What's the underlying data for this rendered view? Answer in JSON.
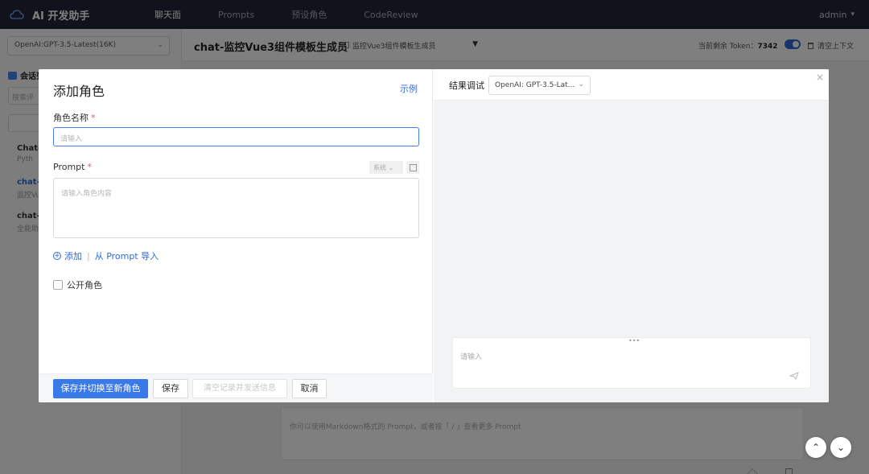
{
  "topbar": {
    "app_title": "AI 开发助手",
    "nav": [
      "聊天面",
      "Prompts",
      "预设角色",
      "CodeReview"
    ],
    "user": "admin"
  },
  "sidebar": {
    "model_select": "OpenAI:GPT-3.5-Latest(16K)",
    "conversation_header": "会话列",
    "search_placeholder": "搜索评",
    "items": [
      {
        "title": "Chat-",
        "subtitle": "Pyth"
      },
      {
        "title": "chat-:",
        "subtitle": "监控Vu"
      },
      {
        "title": "chat-I",
        "subtitle": "全能助"
      }
    ]
  },
  "header": {
    "title": "chat-监控Vue3组件模板生成员",
    "role_chip": "监控Vue3组件模板生成员",
    "token_label": "当前剩余 Token：",
    "token_value": "7342",
    "clear_context": "清空上下文"
  },
  "background_chat": {
    "placeholder": "你可以使用Markdown格式的 Prompt，或者按「 / 」查看更多 Prompt"
  },
  "modal": {
    "title": "添加角色",
    "example_link": "示例",
    "name_label": "角色名称",
    "name_placeholder": "请输入",
    "prompt_label": "Prompt",
    "system_select": "系统",
    "prompt_placeholder": "请输入角色内容",
    "add_label": "添加",
    "import_label": "从 Prompt 导入",
    "public_label": "公开角色",
    "buttons": {
      "save_switch": "保存并切换至新角色",
      "save": "保存",
      "clear_records": "清空记录并发送信息",
      "cancel": "取消"
    },
    "debug_label": "结果调试",
    "debug_model": "OpenAI: GPT-3.5-Lat...",
    "debug_placeholder": "请输入"
  },
  "colors": {
    "primary": "#3a7ae8",
    "topbar": "#202637",
    "link": "#2f6bd6",
    "required": "#e55"
  }
}
